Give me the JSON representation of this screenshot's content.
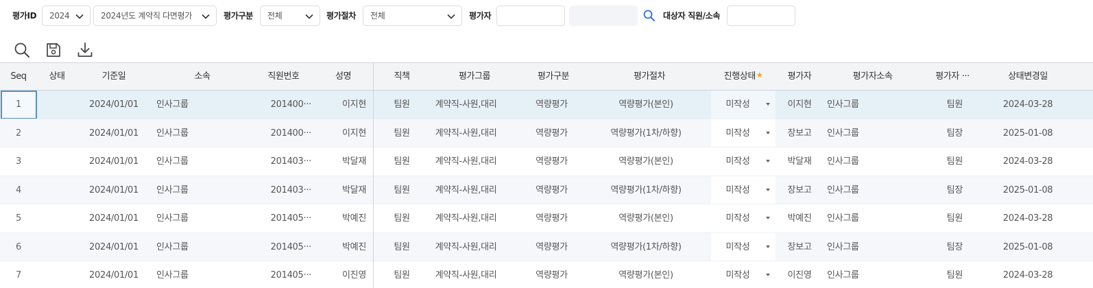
{
  "filters": {
    "eval_id_label": "평가ID",
    "year_value": "2024",
    "eval_name_value": "2024년도 계약직 다면평가",
    "eval_type_label": "평가구분",
    "eval_type_value": "전체",
    "eval_stage_label": "평가절차",
    "eval_stage_value": "전체",
    "evaluator_label": "평가자",
    "evaluator_value": "",
    "target_label": "대상자 직원/소속",
    "target_value": ""
  },
  "toolbar": {
    "icons": [
      "search-icon",
      "save-icon",
      "download-icon"
    ]
  },
  "grid": {
    "columns": {
      "seq": "Seq",
      "state": "상태",
      "base_date": "기준일",
      "dept": "소속",
      "emp_no": "직원번호",
      "name": "성명",
      "position": "직책",
      "eval_group": "평가그룹",
      "eval_type": "평가구분",
      "eval_stage": "평가절차",
      "progress": "진행상태",
      "progress_required": "★",
      "evaluator": "평가자",
      "evaluator_dept": "평가자소속",
      "evaluator_pos": "평가자 ···",
      "status_changed": "상태변경일"
    },
    "rows": [
      {
        "seq": "1",
        "state": "",
        "base_date": "2024/01/01",
        "dept": "인사그룹",
        "emp_no": "201400···",
        "name": "이지현",
        "position": "팀원",
        "eval_group": "계약직-사원,대리",
        "eval_type": "역량평가",
        "eval_stage": "역량평가(본인)",
        "progress": "미작성",
        "evaluator": "이지현",
        "evaluator_dept": "인사그룹",
        "evaluator_pos": "팀원",
        "status_changed": "2024-03-28"
      },
      {
        "seq": "2",
        "state": "",
        "base_date": "2024/01/01",
        "dept": "인사그룹",
        "emp_no": "201400···",
        "name": "이지현",
        "position": "팀원",
        "eval_group": "계약직-사원,대리",
        "eval_type": "역량평가",
        "eval_stage": "역량평가(1차/하향)",
        "progress": "미작성",
        "evaluator": "장보고",
        "evaluator_dept": "인사그룹",
        "evaluator_pos": "팀장",
        "status_changed": "2025-01-08"
      },
      {
        "seq": "3",
        "state": "",
        "base_date": "2024/01/01",
        "dept": "인사그룹",
        "emp_no": "201403···",
        "name": "박달재",
        "position": "팀원",
        "eval_group": "계약직-사원,대리",
        "eval_type": "역량평가",
        "eval_stage": "역량평가(본인)",
        "progress": "미작성",
        "evaluator": "박달재",
        "evaluator_dept": "인사그룹",
        "evaluator_pos": "팀원",
        "status_changed": "2024-03-28"
      },
      {
        "seq": "4",
        "state": "",
        "base_date": "2024/01/01",
        "dept": "인사그룹",
        "emp_no": "201403···",
        "name": "박달재",
        "position": "팀원",
        "eval_group": "계약직-사원,대리",
        "eval_type": "역량평가",
        "eval_stage": "역량평가(1차/하향)",
        "progress": "미작성",
        "evaluator": "장보고",
        "evaluator_dept": "인사그룹",
        "evaluator_pos": "팀장",
        "status_changed": "2025-01-08"
      },
      {
        "seq": "5",
        "state": "",
        "base_date": "2024/01/01",
        "dept": "인사그룹",
        "emp_no": "201405···",
        "name": "박예진",
        "position": "팀원",
        "eval_group": "계약직-사원,대리",
        "eval_type": "역량평가",
        "eval_stage": "역량평가(본인)",
        "progress": "미작성",
        "evaluator": "박예진",
        "evaluator_dept": "인사그룹",
        "evaluator_pos": "팀원",
        "status_changed": "2024-03-28"
      },
      {
        "seq": "6",
        "state": "",
        "base_date": "2024/01/01",
        "dept": "인사그룹",
        "emp_no": "201405···",
        "name": "박예진",
        "position": "팀원",
        "eval_group": "계약직-사원,대리",
        "eval_type": "역량평가",
        "eval_stage": "역량평가(1차/하향)",
        "progress": "미작성",
        "evaluator": "장보고",
        "evaluator_dept": "인사그룹",
        "evaluator_pos": "팀장",
        "status_changed": "2025-01-08"
      },
      {
        "seq": "7",
        "state": "",
        "base_date": "2024/01/01",
        "dept": "인사그룹",
        "emp_no": "201405···",
        "name": "이진영",
        "position": "팀원",
        "eval_group": "계약직-사원,대리",
        "eval_type": "역량평가",
        "eval_stage": "역량평가(본인)",
        "progress": "미작성",
        "evaluator": "이진영",
        "evaluator_dept": "인사그룹",
        "evaluator_pos": "팀원",
        "status_changed": "2024-03-28"
      }
    ]
  },
  "colors": {
    "selected_row": "#e6f0f7",
    "alt_row": "#f5f7fb",
    "header_bg": "#f3f4f6",
    "accent": "#5b8fb9",
    "required_star": "#f0a020",
    "search_blue": "#2f6fd6"
  }
}
